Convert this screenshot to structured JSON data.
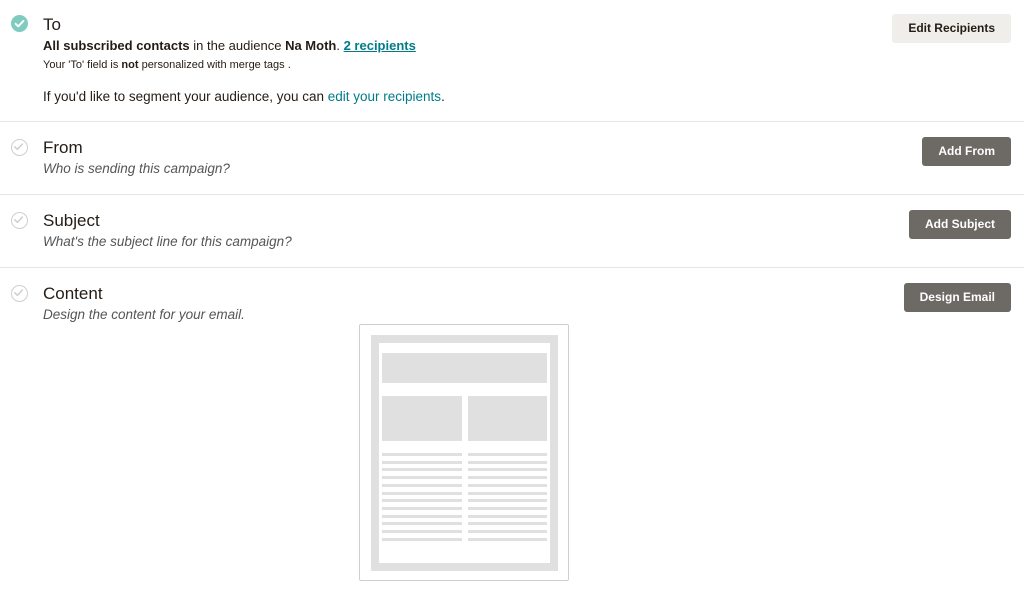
{
  "to": {
    "title": "To",
    "audience_strong": "All subscribed contacts",
    "audience_mid": " in the audience ",
    "audience_name": "Na Moth",
    "audience_dot": ". ",
    "recipients_link": "2 recipients",
    "personalize_pre": "Your 'To' field is ",
    "personalize_strong": "not",
    "personalize_post": " personalized with merge tags .",
    "segment_pre": "If you'd like to segment your audience, you can ",
    "segment_link": "edit your recipients",
    "segment_post": ".",
    "button": "Edit Recipients",
    "status": "complete"
  },
  "from": {
    "title": "From",
    "subtitle": "Who is sending this campaign?",
    "button": "Add From"
  },
  "subject": {
    "title": "Subject",
    "subtitle": "What's the subject line for this campaign?",
    "button": "Add Subject"
  },
  "content": {
    "title": "Content",
    "subtitle": "Design the content for your email.",
    "button": "Design Email"
  },
  "colors": {
    "accent_teal": "#007c89",
    "check_complete": "#7fcbc0",
    "button_dark": "#6d6a66",
    "button_light": "#efeeea"
  },
  "icons": {
    "complete": "check-circle-filled-icon",
    "pending": "check-circle-outline-icon"
  }
}
